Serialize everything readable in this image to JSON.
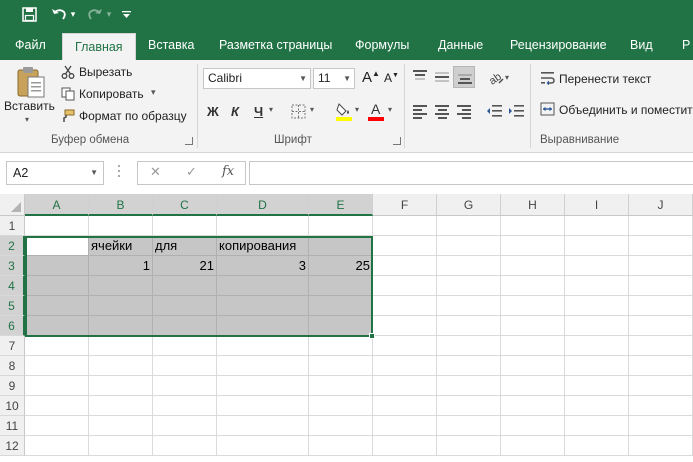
{
  "qat": {
    "save_icon": "save-icon",
    "undo_icon": "undo-icon",
    "redo_icon": "redo-icon",
    "customize_icon": "customize-qat-icon"
  },
  "tabs": [
    "Файл",
    "Главная",
    "Вставка",
    "Разметка страницы",
    "Формулы",
    "Данные",
    "Рецензирование",
    "Вид",
    "Р"
  ],
  "active_tab": "Главная",
  "clipboard": {
    "paste_label": "Вставить",
    "cut_label": "Вырезать",
    "copy_label": "Копировать",
    "format_painter_label": "Формат по образцу",
    "group_label": "Буфер обмена"
  },
  "font": {
    "name": "Calibri",
    "size": "11",
    "increase_label": "A",
    "decrease_label": "A",
    "bold_label": "Ж",
    "italic_label": "К",
    "underline_label": "Ч",
    "fill_color": "#FFFF00",
    "font_color": "#FF0000",
    "group_label": "Шрифт"
  },
  "alignment": {
    "wrap_label": "Перенести текст",
    "merge_label": "Объединить и поместить",
    "group_label": "Выравнивание"
  },
  "formula_bar": {
    "name_box": "A2",
    "fx_label": "fx",
    "cancel_glyph": "✕",
    "enter_glyph": "✓",
    "formula": ""
  },
  "sheet": {
    "columns": [
      "A",
      "B",
      "C",
      "D",
      "E",
      "F",
      "G",
      "H",
      "I",
      "J"
    ],
    "rows": [
      "1",
      "2",
      "3",
      "4",
      "5",
      "6",
      "7",
      "8",
      "9",
      "10",
      "11",
      "12"
    ],
    "cells": {
      "B2": "ячейки",
      "C2": "для",
      "D2": "копирования",
      "B3": "1",
      "C3": "21",
      "D3": "3",
      "E3": "25"
    },
    "selection": "A2:E6",
    "active_cell": "A2"
  },
  "colors": {
    "accent": "#217346",
    "selection_fill": "#C6C6C6"
  }
}
